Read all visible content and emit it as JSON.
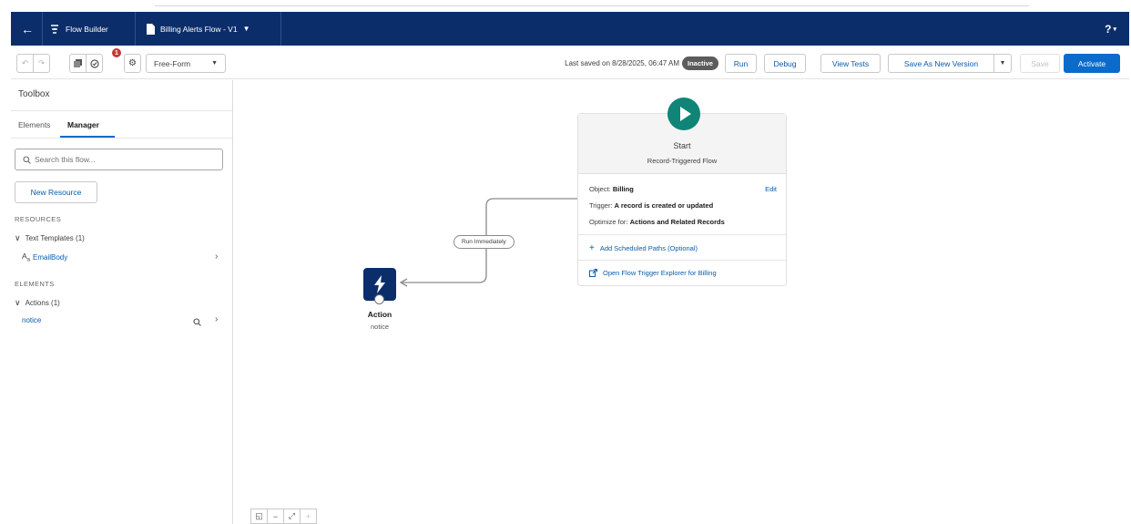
{
  "header": {
    "app_name": "Flow Builder",
    "flow_name": "Billing Alerts Flow - V1",
    "help_label": "?"
  },
  "toolbar": {
    "badge_count": "1",
    "layout_select": "Free-Form",
    "last_saved": "Last saved on 8/28/2025, 06:47 AM",
    "status": "Inactive",
    "run_label": "Run",
    "debug_label": "Debug",
    "view_tests_label": "View Tests",
    "save_new_version_label": "Save As New Version",
    "save_label": "Save",
    "activate_label": "Activate"
  },
  "sidebar": {
    "title": "Toolbox",
    "tabs": [
      "Elements",
      "Manager"
    ],
    "active_tab": "Manager",
    "search_placeholder": "Search this flow...",
    "new_resource_label": "New Resource",
    "resources_heading": "RESOURCES",
    "resource_group": "Text Templates (1)",
    "resource_item": "EmailBody",
    "elements_heading": "ELEMENTS",
    "element_group": "Actions (1)",
    "element_item": "notice"
  },
  "canvas": {
    "start": {
      "title": "Start",
      "subtitle": "Record-Triggered Flow",
      "object_label": "Object:",
      "object_value": "Billing",
      "trigger_label": "Trigger:",
      "trigger_value": "A record is created or updated",
      "optimize_label": "Optimize for:",
      "optimize_value": "Actions and Related Records",
      "edit_label": "Edit",
      "scheduled_paths_label": "Add Scheduled Paths (Optional)",
      "trigger_explorer_label": "Open Flow Trigger Explorer for Billing"
    },
    "connector_label": "Run Immediately",
    "action": {
      "title": "Action",
      "subtitle": "notice"
    }
  },
  "colors": {
    "header_bg": "#0b2e6b",
    "accent": "#0b6bcb",
    "start_green": "#0e8577",
    "badge_red": "#c23934",
    "status_gray": "#5c5c5c"
  },
  "icons": [
    "back-arrow-icon",
    "flow-icon",
    "document-icon",
    "chevron-down-icon",
    "undo-icon",
    "redo-icon",
    "copy-icon",
    "error-check-icon",
    "gear-icon",
    "search-icon",
    "play-icon",
    "lightning-icon",
    "plus-icon",
    "external-link-icon",
    "text-template-icon",
    "chevron-right-icon"
  ]
}
